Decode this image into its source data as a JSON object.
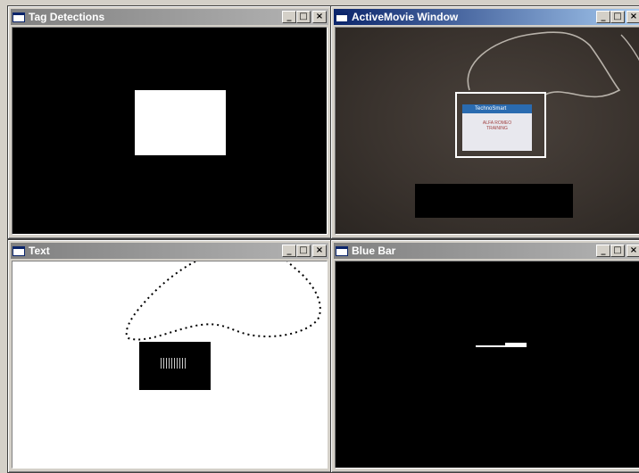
{
  "windows": {
    "tag_detections": {
      "title": "Tag Detections"
    },
    "active_movie": {
      "title": "ActiveMovie Window",
      "card_header": "TechnoSmart",
      "card_line1": "ALFA ROMEO",
      "card_line2": "TRAINING"
    },
    "text": {
      "title": "Text"
    },
    "blue_bar": {
      "title": "Blue Bar"
    }
  },
  "controls": {
    "minimize": "_",
    "maximize": "□",
    "close": "×"
  },
  "colors": {
    "active_title": "#0a246a",
    "inactive_title": "#808080"
  }
}
